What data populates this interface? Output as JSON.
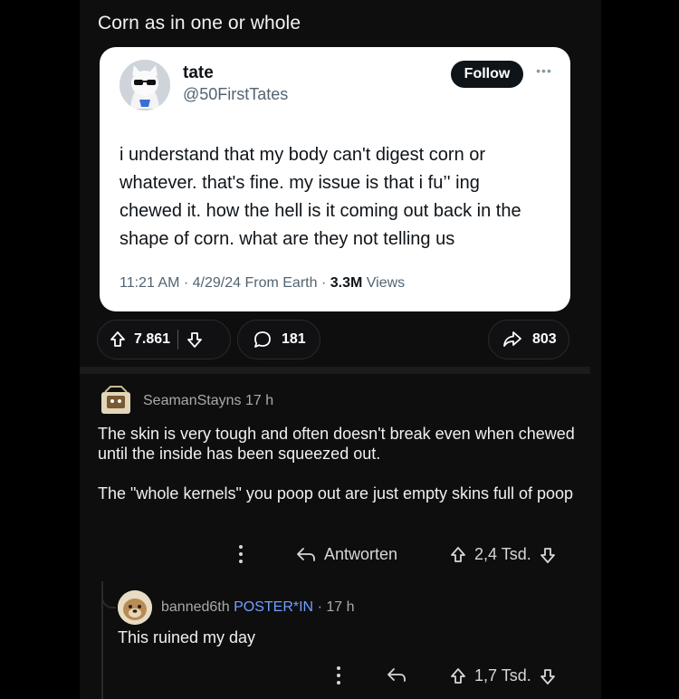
{
  "post": {
    "title": "Corn as in one or whole"
  },
  "tweet": {
    "name": "tate",
    "handle": "@50FirstTates",
    "follow_label": "Follow",
    "body": "i understand that my body can't digest corn or whatever. that's fine. my issue is that i fu’' ing chewed it. how the hell is it coming out back in the shape of corn. what are they not telling us",
    "time": "11:21 AM",
    "date": "4/29/24",
    "source": "From Earth",
    "views_count": "3.3M",
    "views_label": "Views"
  },
  "actions": {
    "upvotes": "7.861",
    "comments": "181",
    "shares": "803"
  },
  "comments": [
    {
      "user": "SeamanStayns",
      "age": "17 h",
      "text_p1": "The skin is very tough and often doesn't break even when chewed until the inside has been squeezed out.",
      "text_p2": "The \"whole kernels\" you poop out are just empty skins full of poop",
      "reply_label": "Antworten",
      "score": "2,4 Tsd."
    },
    {
      "user": "banned6th",
      "flair": "POSTER*IN",
      "age": "17 h",
      "text": "This ruined my day",
      "score": "1,7 Tsd."
    }
  ],
  "icons": {
    "upvote": "arrow-up-icon",
    "downvote": "arrow-down-icon",
    "comment": "speech-bubble-icon",
    "share": "share-arrow-icon",
    "more": "vertical-dots-icon",
    "reply": "reply-arrow-icon"
  }
}
